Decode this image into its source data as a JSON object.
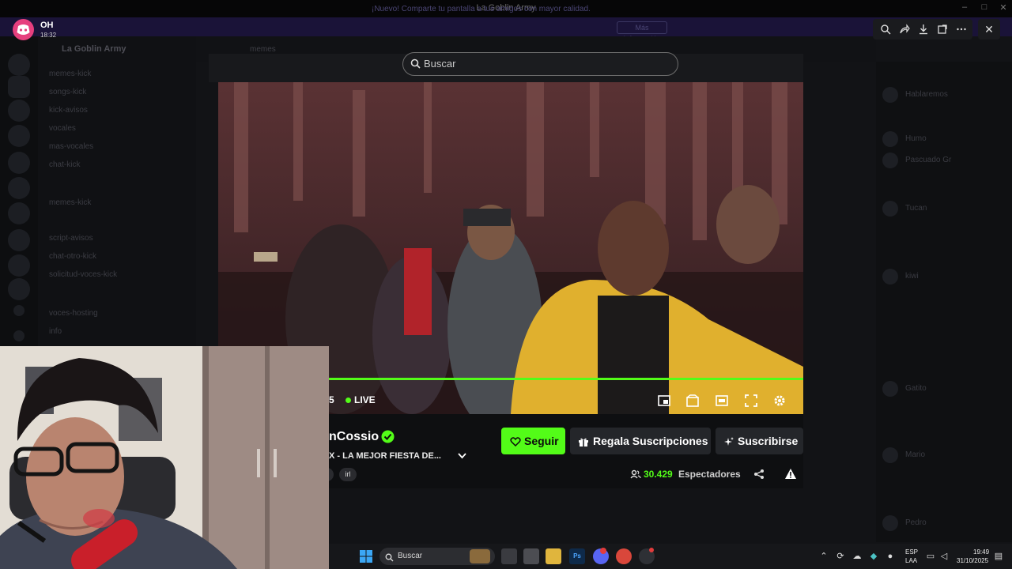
{
  "window": {
    "title": "La Goblin Army"
  },
  "notice": {
    "text": "¡Nuevo! Comparte tu pantalla a tus amigos con mayor calidad.",
    "button": "Más Información"
  },
  "discord_notification": {
    "user": "OH",
    "time": "18:32"
  },
  "background": {
    "server_name": "La Goblin Army",
    "channels": [
      "memes-kick",
      "songs-kick",
      "kick-avisos",
      "vocales",
      "mas-vocales",
      "chat-kick",
      "script-avisos",
      "chat-otro-kick",
      "solicitud-voces-kick",
      "voces-hosting",
      "info"
    ],
    "topbar_channel": "memes",
    "members": [
      "Hablaremos",
      "Humo",
      "Pascuado Gr",
      "Tucan",
      "kiwi",
      "Gatito",
      "Mario",
      "Pedro"
    ]
  },
  "viewer_toolbar": {
    "icons": [
      "zoom-icon",
      "forward-icon",
      "download-icon",
      "open-external-icon",
      "more-icon"
    ],
    "close": "✕"
  },
  "kick": {
    "search_placeholder": "Buscar",
    "viewers_partial": "5",
    "live_label": "LIVE",
    "channel_name": "nCossio",
    "stream_title": "X - LA MEJOR FIESTA DE...",
    "tags": [
      "",
      "irl"
    ],
    "follow_label": "Seguir",
    "gift_label": "Regala Suscripciones",
    "subscribe_label": "Suscribirse",
    "viewer_count": "30.429",
    "viewer_label": "Espectadores",
    "accent": "#53fc18"
  },
  "taskbar": {
    "search_placeholder": "Buscar",
    "lang_top": "ESP",
    "lang_bottom": "LAA",
    "time": "19:49",
    "date": "31/10/2025"
  }
}
